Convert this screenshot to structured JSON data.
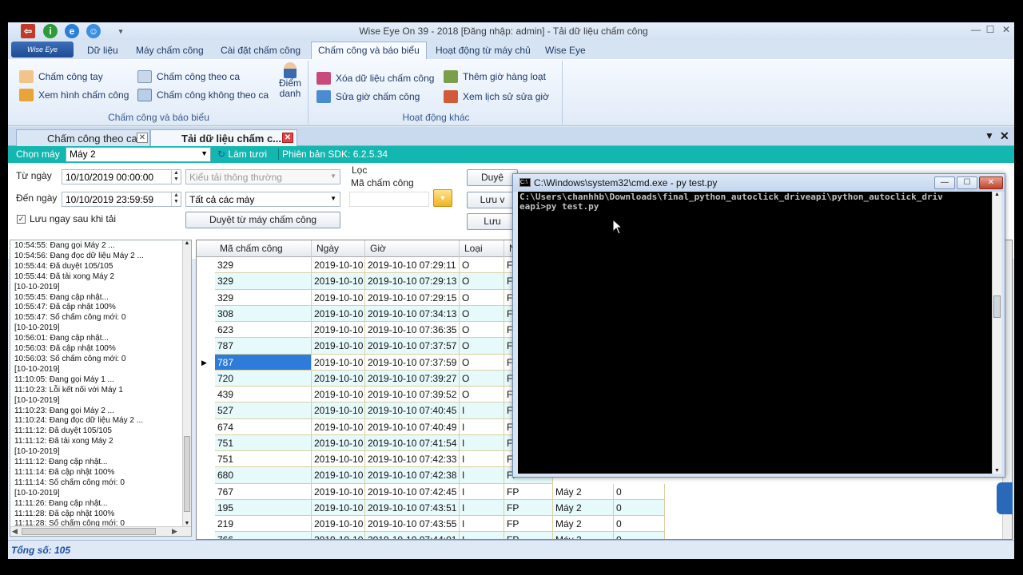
{
  "window": {
    "title": "Wise Eye On 39 - 2018 [Đăng nhập: admin] - Tải dữ liệu chấm công",
    "app_button": "Wise Eye"
  },
  "ribbon_tabs": [
    "Dữ liệu",
    "Máy chấm công",
    "Cài đặt chấm công",
    "Chấm công và báo biểu",
    "Hoạt động từ máy chủ",
    "Wise Eye"
  ],
  "ribbon": {
    "group1_label": "Chấm công và báo biểu",
    "group2_label": "Hoạt động khác",
    "cham_cong_tay": "Chấm công tay",
    "xem_hinh": "Xem hình chấm công",
    "theo_ca": "Chấm công theo ca",
    "khong_theo_ca": "Chấm công không theo ca",
    "diem_danh": "Điểm danh",
    "xoa_du_lieu": "Xóa dữ liệu chấm công",
    "sua_gio": "Sửa giờ chấm công",
    "them_gio": "Thêm giờ hàng loạt",
    "xem_lich_su": "Xem lịch sử sửa giờ"
  },
  "doc_tabs": [
    "Chấm công theo ca",
    "Tải dữ liệu chấm c..."
  ],
  "toolbar": {
    "chon_may_label": "Chọn máy",
    "selected_machine": "Máy 2",
    "refresh": "Làm tươi",
    "sdk": "Phiên bản SDK: 6.2.5.34"
  },
  "filters": {
    "tu_ngay_label": "Từ ngày",
    "tu_ngay_value": "10/10/2019 00:00:00",
    "den_ngay_label": "Đến ngày",
    "den_ngay_value": "10/10/2019 23:59:59",
    "luu_ngay": "Lưu ngay sau khi tải",
    "kieu_tai": "Kiểu tải thông thường",
    "tat_ca_may": "Tất cả các máy",
    "duyet_btn": "Duyệt từ máy chấm công",
    "loc_label": "Lọc",
    "ma_cham_cong_label": "Mã chấm công",
    "btn_duyet": "Duyệ",
    "btn_luu_v": "Lưu v",
    "btn_luu": "Lưu"
  },
  "log": [
    "10:54:55: Đang gọi Máy 2 ...",
    "10:54:56: Đang đọc dữ liệu Máy 2 ...",
    "10:55:44: Đã duyệt 105/105",
    "10:55:44: Đã tải xong Máy 2",
    "[10-10-2019]",
    "10:55:45: Đang cập nhật...",
    "10:55:47: Đã cập nhật 100%",
    "10:55:47: Số chấm công mới: 0",
    "[10-10-2019]",
    "10:56:01: Đang cập nhật...",
    "10:56:03: Đã cập nhật 100%",
    "10:56:03: Số chấm công mới: 0",
    "[10-10-2019]",
    "11:10:05: Đang gọi Máy 1 ...",
    "11:10:23: Lỗi kết nối với Máy 1",
    "[10-10-2019]",
    "11:10:23: Đang gọi Máy 2 ...",
    "11:10:24: Đang đọc dữ liệu Máy 2 ...",
    "11:11:12: Đã duyệt 105/105",
    "11:11:12: Đã tải xong Máy 2",
    "[10-10-2019]",
    "11:11:12: Đang cập nhật...",
    "11:11:14: Đã cập nhật 100%",
    "11:11:14: Số chấm công mới: 0",
    "[10-10-2019]",
    "11:11:26: Đang cập nhật...",
    "11:11:28: Đã cập nhật 100%",
    "11:11:28: Số chấm công mới: 0"
  ],
  "grid": {
    "headers": [
      "Mã chấm công",
      "Ngày",
      "Giờ",
      "Loại",
      "N"
    ],
    "rows": [
      [
        "329",
        "2019-10-10",
        "2019-10-10 07:29:11",
        "O",
        "FP",
        "",
        ""
      ],
      [
        "329",
        "2019-10-10",
        "2019-10-10 07:29:13",
        "O",
        "FP",
        "",
        ""
      ],
      [
        "329",
        "2019-10-10",
        "2019-10-10 07:29:15",
        "O",
        "FP",
        "",
        ""
      ],
      [
        "308",
        "2019-10-10",
        "2019-10-10 07:34:13",
        "O",
        "FP",
        "",
        ""
      ],
      [
        "623",
        "2019-10-10",
        "2019-10-10 07:36:35",
        "O",
        "FP",
        "",
        ""
      ],
      [
        "787",
        "2019-10-10",
        "2019-10-10 07:37:57",
        "O",
        "FP",
        "",
        ""
      ],
      [
        "787",
        "2019-10-10",
        "2019-10-10 07:37:59",
        "O",
        "FP",
        "",
        ""
      ],
      [
        "720",
        "2019-10-10",
        "2019-10-10 07:39:27",
        "O",
        "FP",
        "",
        ""
      ],
      [
        "439",
        "2019-10-10",
        "2019-10-10 07:39:52",
        "O",
        "FP",
        "",
        ""
      ],
      [
        "527",
        "2019-10-10",
        "2019-10-10 07:40:45",
        "I",
        "FP",
        "",
        ""
      ],
      [
        "674",
        "2019-10-10",
        "2019-10-10 07:40:49",
        "I",
        "FP",
        "",
        ""
      ],
      [
        "751",
        "2019-10-10",
        "2019-10-10 07:41:54",
        "I",
        "FP",
        "",
        ""
      ],
      [
        "751",
        "2019-10-10",
        "2019-10-10 07:42:33",
        "I",
        "FP",
        "",
        ""
      ],
      [
        "680",
        "2019-10-10",
        "2019-10-10 07:42:38",
        "I",
        "FP",
        "",
        ""
      ],
      [
        "767",
        "2019-10-10",
        "2019-10-10 07:42:45",
        "I",
        "FP",
        "Máy 2",
        "0"
      ],
      [
        "195",
        "2019-10-10",
        "2019-10-10 07:43:51",
        "I",
        "FP",
        "Máy 2",
        "0"
      ],
      [
        "219",
        "2019-10-10",
        "2019-10-10 07:43:55",
        "I",
        "FP",
        "Máy 2",
        "0"
      ],
      [
        "766",
        "2019-10-10",
        "2019-10-10 07:44:01",
        "I",
        "FP",
        "Máy 2",
        "0"
      ]
    ],
    "selected_row": 6
  },
  "status": {
    "total": "Tổng số: 105"
  },
  "cmd": {
    "title": "C:\\Windows\\system32\\cmd.exe - py  test.py",
    "text": "C:\\Users\\chanhhb\\Downloads\\final_python_autoclick_driveapi\\python_autoclick_driv\neapi>py test.py"
  }
}
